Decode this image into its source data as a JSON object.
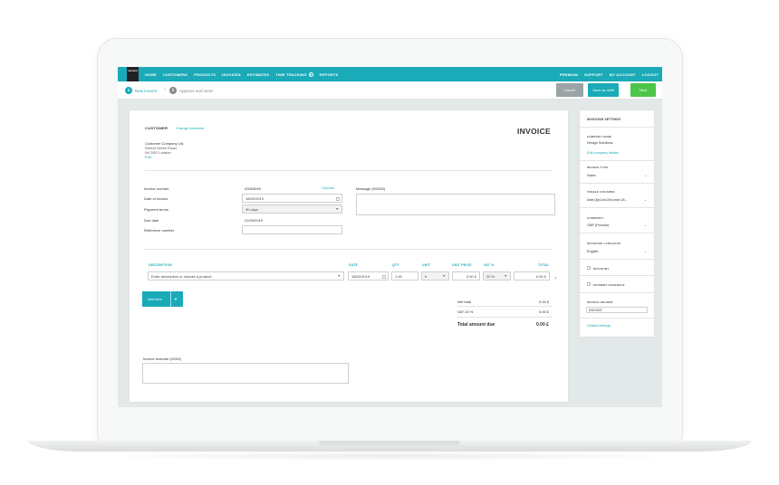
{
  "nav": {
    "logo_text": "zervant",
    "left_items": [
      "HOME",
      "CUSTOMERS",
      "PRODUCTS",
      "INVOICES",
      "ESTIMATES",
      "TIME TRACKING",
      "REPORTS"
    ],
    "right_items": [
      "PREMIUM",
      "SUPPORT",
      "MY ACCOUNT",
      "LOGOUT"
    ]
  },
  "stepper": {
    "step1_num": "1",
    "step1_label": "New invoice",
    "step2_num": "2",
    "step2_label": "Approve and send",
    "cancel": "Cancel",
    "save_draft": "Save as draft",
    "next": "Next"
  },
  "invoice": {
    "title": "INVOICE",
    "customer_label": "CUSTOMER",
    "change_customer": "Change customer",
    "customer_name": "Customer Company Ltd.",
    "customer_address1": "Stroud Green Road",
    "customer_address2": "N4 3SG London",
    "edit": "Edit",
    "invoice_number_label": "Invoice number",
    "invoice_number": "20063049",
    "choose": "Choose",
    "date_label": "Date of invoice",
    "date_value": "18/02/2019",
    "payment_terms_label": "Payment terms",
    "payment_terms_value": "30 days",
    "due_date_label": "Due date",
    "due_date_value": "21/03/2019",
    "reference_label": "Reference number",
    "reference_value": "",
    "message_label": "Message (0/3000)",
    "col_description": "DESCRIPTION",
    "col_date": "DATE",
    "col_qty": "QTY",
    "col_unit": "UNIT",
    "col_unit_price": "UNIT PRICE",
    "col_vat": "VAT %",
    "col_total": "TOTAL",
    "row": {
      "description_placeholder": "Enter description or choose a product",
      "date": "18/02/2019",
      "qty": "1.00",
      "unit": "h",
      "unit_price": "0.00 £",
      "vat": "20 %",
      "total": "0.00 £"
    },
    "add_item": "Add item",
    "net_total_label": "Net total",
    "net_total_value": "0.00 £",
    "vat_label": "VAT 20 %",
    "vat_value": "0.00 £",
    "total_due_label": "Total amount due",
    "total_due_value": "0.00 £",
    "footnote_label": "Invoice footnote (0/250)"
  },
  "settings": {
    "title": "INVOICING SETTINGS",
    "company_name_label": "COMPANY NAME",
    "company_name": "Design Solutions",
    "edit_company": "Edit company details",
    "invoice_type_label": "INVOICE TYPE",
    "invoice_type": "Sales",
    "visible_columns_label": "VISIBLE COLUMNS",
    "visible_columns": "Date,Qty,Unit,Unit price,VA...",
    "currency_label": "CURRENCY",
    "currency": "GBP (Pounds)",
    "language_label": "INVOICING LANGUAGE",
    "language": "English",
    "discount_label": "DISCOUNT",
    "payment_schedule_label": "PAYMENT SCHEDULE",
    "header_label": "INVOICE HEADER",
    "header_value": "INVOICE",
    "default_settings": "Default settings"
  },
  "colors": {
    "accent": "#1aaab8",
    "next_button": "#4cc64a",
    "cancel_button": "#9aa3a5"
  }
}
